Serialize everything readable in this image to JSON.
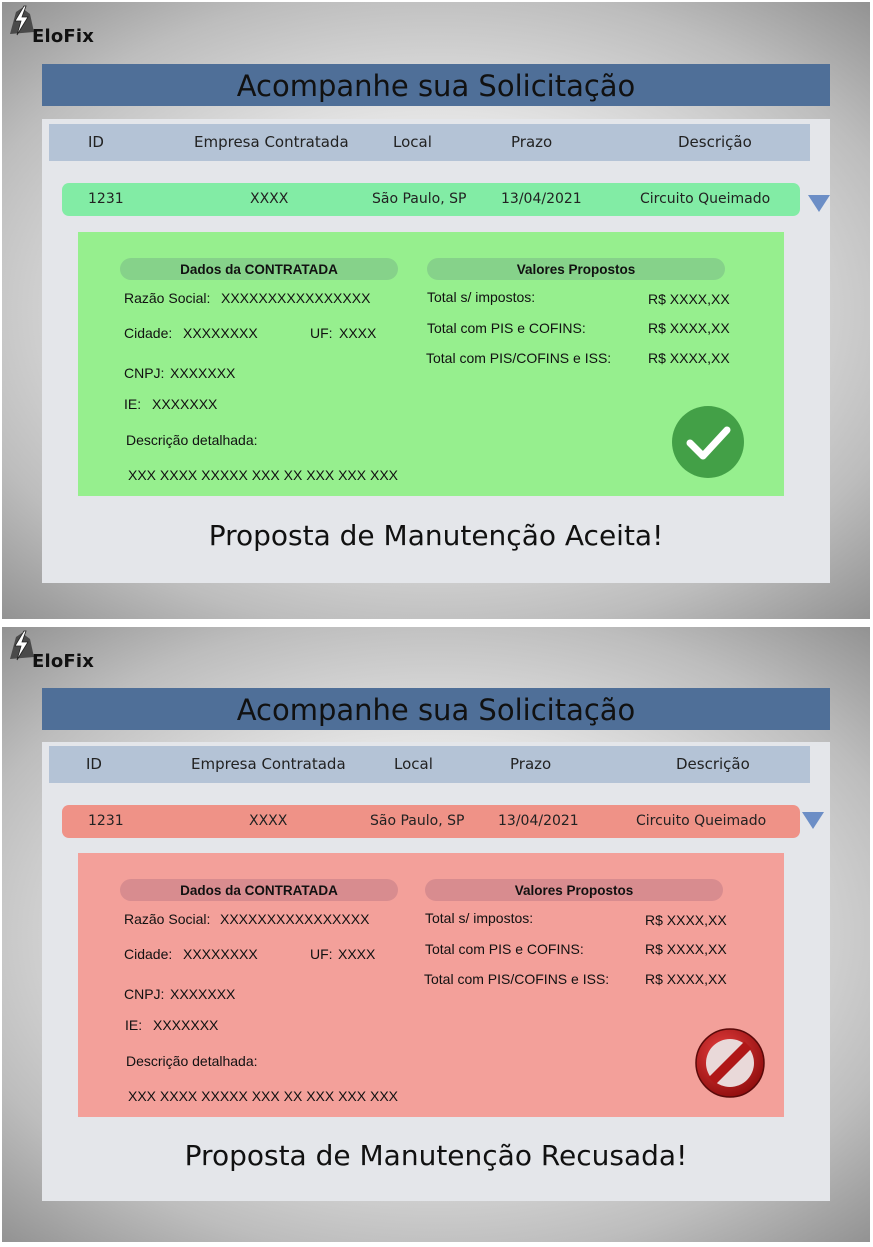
{
  "app": {
    "name": "EloFix",
    "logo_icon": "lightning-bolt-icon"
  },
  "screens": [
    {
      "status": "accepted",
      "title": "Acompanhe sua Solicitação",
      "columns": [
        "ID",
        "Empresa Contratada",
        "Local",
        "Prazo",
        "Descrição"
      ],
      "row": {
        "id": "1231",
        "empresa": "XXXX",
        "local": "São Paulo, SP",
        "prazo": "13/04/2021",
        "descricao": "Circuito Queimado"
      },
      "row_color": "#82eca5",
      "expand_icon": "triangle-down-icon",
      "detail": {
        "dados_title": "Dados da CONTRATADA",
        "razao_label": "Razão Social:",
        "razao_value": "XXXXXXXXXXXXXXXX",
        "cidade_label": "Cidade:",
        "cidade_value": "XXXXXXXX",
        "uf_label": "UF:",
        "uf_value": "XXXX",
        "cnpj_label": "CNPJ:",
        "cnpj_value": "XXXXXXX",
        "ie_label": "IE:",
        "ie_value": "XXXXXXX",
        "desc_label": "Descrição detalhada:",
        "desc_value": "XXX XXXX XXXXX XXX XX XXX XXX XXX",
        "valores_title": "Valores Propostos",
        "total1_label": "Total s/ impostos:",
        "total1_value": "R$ XXXX,XX",
        "total2_label": "Total com PIS e COFINS:",
        "total2_value": "R$ XXXX,XX",
        "total3_label": "Total com PIS/COFINS e ISS:",
        "total3_value": "R$ XXXX,XX"
      },
      "status_icon": "checkmark-circle-icon",
      "result_text": "Proposta de Manutenção Aceita!",
      "detail_color": "#96ef8e"
    },
    {
      "status": "rejected",
      "title": "Acompanhe sua Solicitação",
      "columns": [
        "ID",
        "Empresa Contratada",
        "Local",
        "Prazo",
        "Descrição"
      ],
      "row": {
        "id": "1231",
        "empresa": "XXXX",
        "local": "São Paulo, SP",
        "prazo": "13/04/2021",
        "descricao": "Circuito Queimado"
      },
      "row_color": "#ef9287",
      "expand_icon": "triangle-down-icon",
      "detail": {
        "dados_title": "Dados da CONTRATADA",
        "razao_label": "Razão Social:",
        "razao_value": "XXXXXXXXXXXXXXXX",
        "cidade_label": "Cidade:",
        "cidade_value": "XXXXXXXX",
        "uf_label": "UF:",
        "uf_value": "XXXX",
        "cnpj_label": "CNPJ:",
        "cnpj_value": "XXXXXXX",
        "ie_label": "IE:",
        "ie_value": "XXXXXXX",
        "desc_label": "Descrição detalhada:",
        "desc_value": "XXX XXXX XXXXX XXX XX XXX XXX XXX",
        "valores_title": "Valores Propostos",
        "total1_label": "Total s/ impostos:",
        "total1_value": "R$ XXXX,XX",
        "total2_label": "Total com PIS e COFINS:",
        "total2_value": "R$ XXXX,XX",
        "total3_label": "Total com PIS/COFINS e ISS:",
        "total3_value": "R$ XXXX,XX"
      },
      "status_icon": "prohibited-icon",
      "result_text": "Proposta de Manutenção Recusada!",
      "detail_color": "#f3a09a"
    }
  ]
}
